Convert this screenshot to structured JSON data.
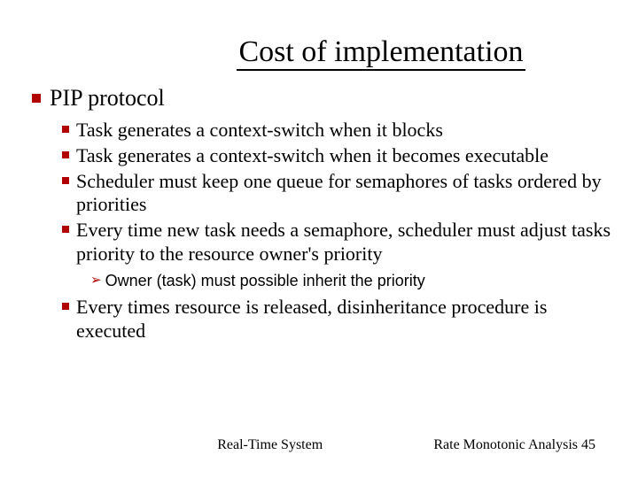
{
  "title": "Cost of implementation",
  "main_bullet": "PIP protocol",
  "sub": {
    "b1": "Task generates a context-switch when it blocks",
    "b2": "Task generates a context-switch when it becomes executable",
    "b3": "Scheduler must keep one queue for semaphores of tasks ordered by priorities",
    "b4": "Every time new task needs a semaphore, scheduler must adjust tasks priority to the resource owner's priority",
    "b4_sub": "Owner (task) must possible inherit the priority",
    "b5": "Every times resource is released, disinheritance procedure is executed"
  },
  "footer": {
    "center": "Real-Time System",
    "right_label": "Rate Monotonic Analysis",
    "right_num": "45"
  }
}
